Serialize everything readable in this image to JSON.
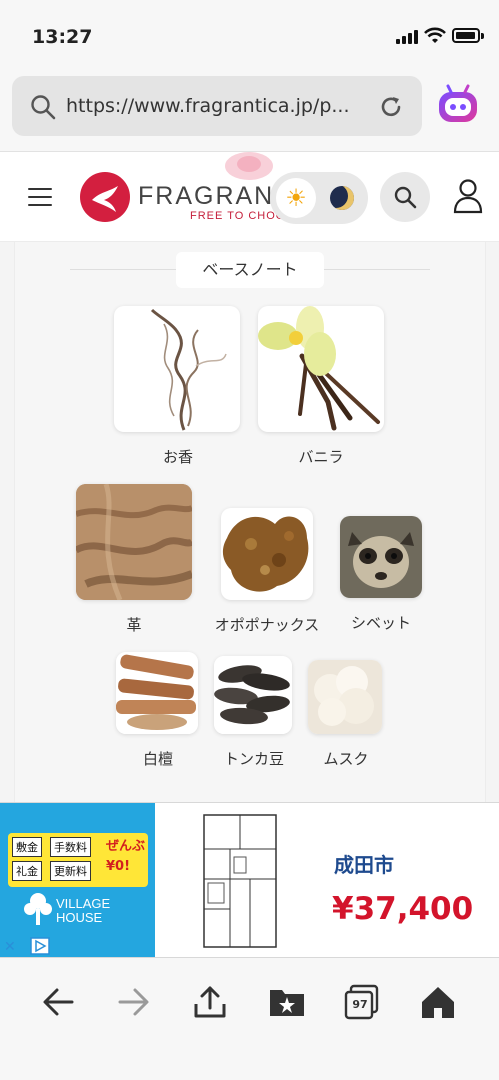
{
  "status_bar": {
    "time": "13:27"
  },
  "browser": {
    "url": "https://www.fragrantica.jp/p..."
  },
  "site": {
    "logo_text": "FRAGRANTICA",
    "logo_tagline": "FREE TO CHOOSE"
  },
  "section": {
    "title": "ベースノート",
    "notes": [
      {
        "label": "お香"
      },
      {
        "label": "バニラ"
      },
      {
        "label": "革"
      },
      {
        "label": "オポポナックス"
      },
      {
        "label": "シベット"
      },
      {
        "label": "白檀"
      },
      {
        "label": "トンカ豆"
      },
      {
        "label": "ムスク"
      }
    ]
  },
  "ad": {
    "chip1": "敷金",
    "chip2": "手数料",
    "chip3": "礼金",
    "chip4": "更新料",
    "promo_line1": "ぜんぶ",
    "promo_line2": "¥0!",
    "brand_line1": "VILLAGE",
    "brand_line2": "HOUSE",
    "city": "成田市",
    "price": "¥37,400"
  },
  "toolbar": {
    "tabs_count": "97"
  },
  "colors": {
    "brand": "#d31f3f",
    "ad_blue": "#24a6df",
    "ad_price": "#d3142b",
    "ad_city": "#1e4a8e"
  }
}
